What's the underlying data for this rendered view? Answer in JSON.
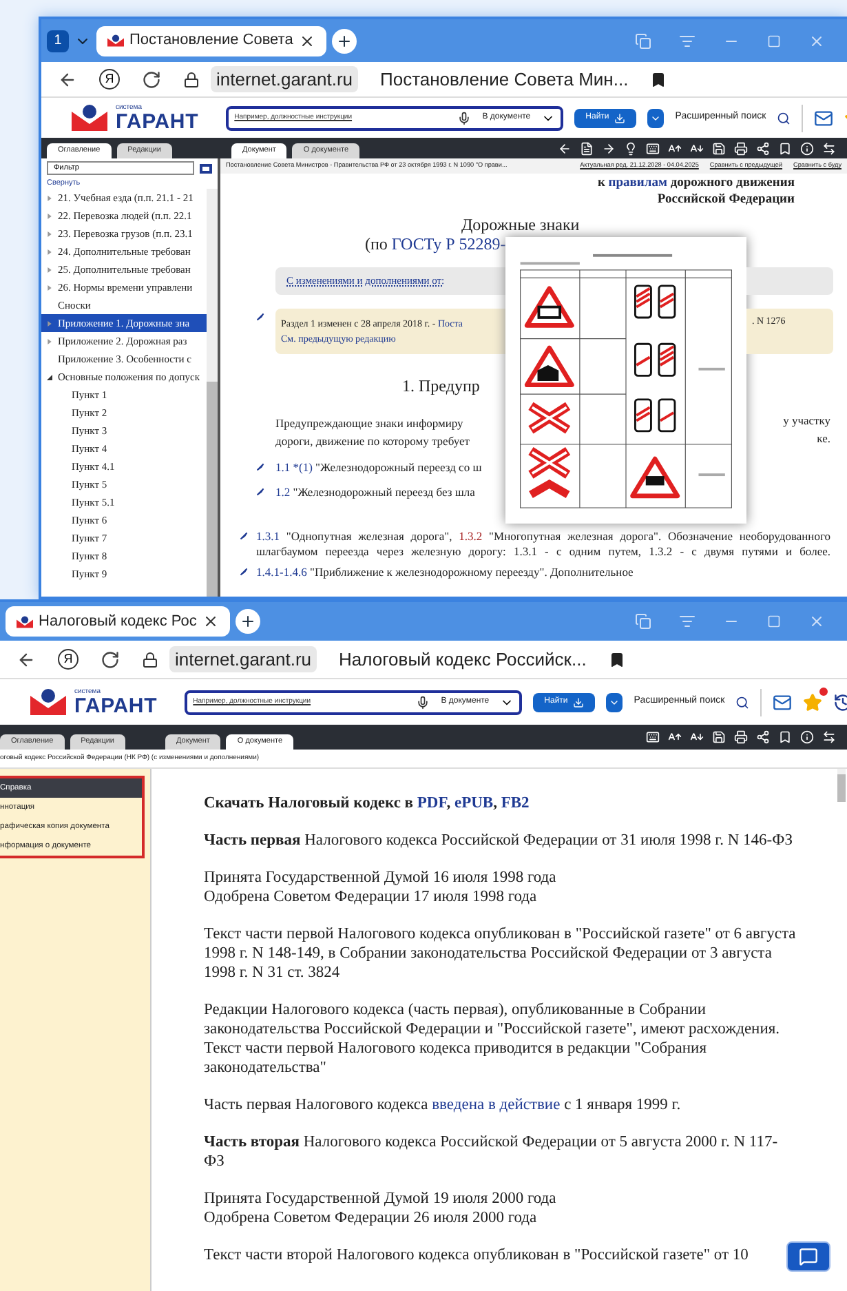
{
  "window_top": {
    "tab_counter": "1",
    "tab": {
      "title": "Постановление Совета"
    },
    "address": {
      "home_glyph": "Я",
      "domain": "internet.garant.ru",
      "page_title": "Постановление Совета Мин..."
    },
    "header": {
      "logo_caption": "система",
      "logo_name": "ГАРАНТ",
      "search_placeholder": "Например, должностные инструкции",
      "scope": "В документе",
      "find_button": "Найти",
      "advanced_search": "Расширенный поиск"
    },
    "panel_tabs": [
      {
        "label": "Оглавление",
        "selected": true
      },
      {
        "label": "Редакции",
        "selected": false
      }
    ],
    "doc_tabs": [
      {
        "label": "Документ",
        "selected": true
      },
      {
        "label": "О документе",
        "selected": false
      }
    ],
    "doc_bar": {
      "title": "Постановление Совета Министров - Правительства РФ от 23 октября 1993 г. N 1090 \"О прави...",
      "links": [
        "Актуальная ред. 21.12.2028 - 04.04.2025",
        "Сравнить с предыдущей",
        "Сравнить с буду"
      ]
    },
    "filter": {
      "value": "Фильтр"
    },
    "collapse_link": "Свернуть",
    "tree": [
      {
        "label": "21. Учебная езда (п.п. 21.1 - 21",
        "kind": "node",
        "expanded": false,
        "selected": false
      },
      {
        "label": "22. Перевозка людей (п.п. 22.1",
        "kind": "node",
        "expanded": false,
        "selected": false
      },
      {
        "label": "23. Перевозка грузов (п.п. 23.1",
        "kind": "node",
        "expanded": false,
        "selected": false
      },
      {
        "label": "24. Дополнительные требован",
        "kind": "node",
        "expanded": false,
        "selected": false
      },
      {
        "label": "25. Дополнительные требован",
        "kind": "node",
        "expanded": false,
        "selected": false
      },
      {
        "label": "26. Нормы времени управлени",
        "kind": "node",
        "expanded": false,
        "selected": false
      },
      {
        "label": "Сноски",
        "kind": "leaf",
        "selected": false
      },
      {
        "label": "Приложение 1. Дорожные зна",
        "kind": "node",
        "expanded": false,
        "selected": true
      },
      {
        "label": "Приложение 2. Дорожная раз",
        "kind": "node",
        "expanded": false,
        "selected": false
      },
      {
        "label": "Приложение 3. Особенности с",
        "kind": "leaf",
        "selected": false
      },
      {
        "label": "Основные положения по допуск",
        "kind": "node",
        "expanded": true,
        "selected": false,
        "children": [
          {
            "label": "Пункт 1",
            "selected": false
          },
          {
            "label": "Пункт 2",
            "selected": false
          },
          {
            "label": "Пункт 3",
            "selected": false
          },
          {
            "label": "Пункт 4",
            "selected": false
          },
          {
            "label": "Пункт 4.1",
            "selected": false
          },
          {
            "label": "Пункт 5",
            "selected": false
          },
          {
            "label": "Пункт 5.1",
            "selected": false
          },
          {
            "label": "Пункт 6",
            "selected": false
          },
          {
            "label": "Пункт 7",
            "selected": false
          },
          {
            "label": "Пункт 8",
            "selected": false
          },
          {
            "label": "Пункт 9",
            "selected": false
          }
        ]
      }
    ],
    "document": {
      "annex_lines": [
        [
          {
            "text": "к ",
            "kind": "plain"
          },
          {
            "text": "правилам",
            "kind": "link"
          },
          {
            "text": " дорожного движения",
            "kind": "plain"
          }
        ],
        [
          {
            "text": "Российской Федерации",
            "kind": "plain"
          }
        ]
      ],
      "title": "Дорожные знаки",
      "standard_line": [
        {
          "text": "(по ",
          "kind": "plain"
        },
        {
          "text": "ГОСТу Р 52289-",
          "kind": "link"
        }
      ],
      "changes_link": "С изменениями и дополнениями от:",
      "notice": {
        "left": [
          {
            "text": "Раздел 1 изменен с 28 апреля 2018 г. - ",
            "kind": "plain"
          },
          {
            "text": "Поста",
            "kind": "link"
          }
        ],
        "right": ". N 1276",
        "previous_link": "См. предыдущую редакцию"
      },
      "section_heading": "1. Предупр",
      "intro_lines": [
        {
          "left": "Предупреждающие знаки информиру",
          "right": "у участку"
        },
        {
          "left": "дороги, движение по которому требует",
          "right": "ке."
        }
      ],
      "cut_items": [
        [
          {
            "text": "1.1 *(1)",
            "kind": "link"
          },
          {
            "text": " \"Железнодорожный переезд со ш",
            "kind": "plain"
          }
        ],
        [
          {
            "text": "1.2",
            "kind": "link"
          },
          {
            "text": " \"Железнодорожный переезд без шла",
            "kind": "plain"
          }
        ]
      ],
      "items": [
        [
          {
            "text": "1.3.1",
            "kind": "link"
          },
          {
            "text": " \"Однопутная железная дорога\", ",
            "kind": "plain"
          },
          {
            "text": "1.3.2",
            "kind": "visited"
          },
          {
            "text": " \"Многопутная железная дорога\". Обозначение необорудованного шлагбаумом переезда через железную дорогу: 1.3.1 - с одним путем, 1.3.2 - с двумя путями и более.",
            "kind": "plain"
          }
        ],
        [
          {
            "text": "1.4.1-1.4.6",
            "kind": "link"
          },
          {
            "text": " \"Приближение к железнодорожному переезду\". Дополнительное",
            "kind": "plain"
          }
        ]
      ]
    }
  },
  "window_bottom": {
    "tab": {
      "title": "Налоговый кодекс Рос"
    },
    "address": {
      "home_glyph": "Я",
      "domain": "internet.garant.ru",
      "page_title": "Налоговый кодекс Российск..."
    },
    "header": {
      "logo_caption": "система",
      "logo_name": "ГАРАНТ",
      "search_placeholder": "Например, должностные инструкции",
      "scope": "В документе",
      "find_button": "Найти",
      "advanced_search": "Расширенный поиск"
    },
    "panel_tabs": [
      {
        "label": "Оглавление",
        "selected": false
      },
      {
        "label": "Редакции",
        "selected": false
      }
    ],
    "doc_tabs": [
      {
        "label": "Документ",
        "selected": false
      },
      {
        "label": "О документе",
        "selected": true
      }
    ],
    "doc_bar": {
      "title": "оговый кодекс Российской Федерации (НК РФ) (с изменениями и дополнениями)"
    },
    "sidebar_items": [
      {
        "label": "Справка",
        "selected": true
      },
      {
        "label": "ннотация",
        "selected": false
      },
      {
        "label": "рафическая копия документа",
        "selected": false
      },
      {
        "label": "нформация о документе",
        "selected": false
      }
    ],
    "paragraphs": [
      [
        [
          {
            "text": "Скачать Налоговый кодекс в ",
            "kind": "bold"
          },
          {
            "text": "PDF",
            "kind": "boldlink"
          },
          {
            "text": ", ",
            "kind": "bold"
          },
          {
            "text": "ePUB",
            "kind": "boldlink"
          },
          {
            "text": ", ",
            "kind": "bold"
          },
          {
            "text": "FB2",
            "kind": "boldlink"
          }
        ]
      ],
      [
        [
          {
            "text": "Часть первая",
            "kind": "bold"
          },
          {
            "text": " Налогового кодекса Российской Федерации от 31 июля 1998 г. N 146-ФЗ",
            "kind": "plain"
          }
        ]
      ],
      [
        [
          {
            "text": "Принята Государственной Думой 16 июля 1998 года",
            "kind": "plain"
          }
        ],
        [
          {
            "text": "Одобрена Советом Федерации 17 июля 1998 года",
            "kind": "plain"
          }
        ]
      ],
      [
        [
          {
            "text": "Текст части первой Налогового кодекса опубликован в \"Российской газете\" от 6 августа 1998 г. N 148-149, в Собрании законодательства Российской Федерации от 3 августа 1998 г. N 31 ст. 3824",
            "kind": "plain"
          }
        ]
      ],
      [
        [
          {
            "text": "Редакции Налогового кодекса (часть первая), опубликованные в Собрании законодательства Российской Федерации и \"Российской газете\", имеют расхождения. Текст части первой Налогового кодекса приводится в редакции \"Собрания законодательства\"",
            "kind": "plain"
          }
        ]
      ],
      [
        [
          {
            "text": "Часть первая Налогового кодекса ",
            "kind": "plain"
          },
          {
            "text": "введена в действие",
            "kind": "link"
          },
          {
            "text": " с 1 января 1999 г.",
            "kind": "plain"
          }
        ]
      ],
      [
        [
          {
            "text": "Часть вторая",
            "kind": "bold"
          },
          {
            "text": " Налогового кодекса Российской Федерации от 5 августа 2000 г. N 117-ФЗ",
            "kind": "plain"
          }
        ]
      ],
      [
        [
          {
            "text": "Принята Государственной Думой 19 июля 2000 года",
            "kind": "plain"
          }
        ],
        [
          {
            "text": "Одобрена Советом Федерации 26 июля 2000 года",
            "kind": "plain"
          }
        ]
      ],
      [
        [
          {
            "text": "Текст части второй Налогового кодекса опубликован в \"Российской газете\" от 10",
            "kind": "plain"
          }
        ]
      ]
    ]
  }
}
